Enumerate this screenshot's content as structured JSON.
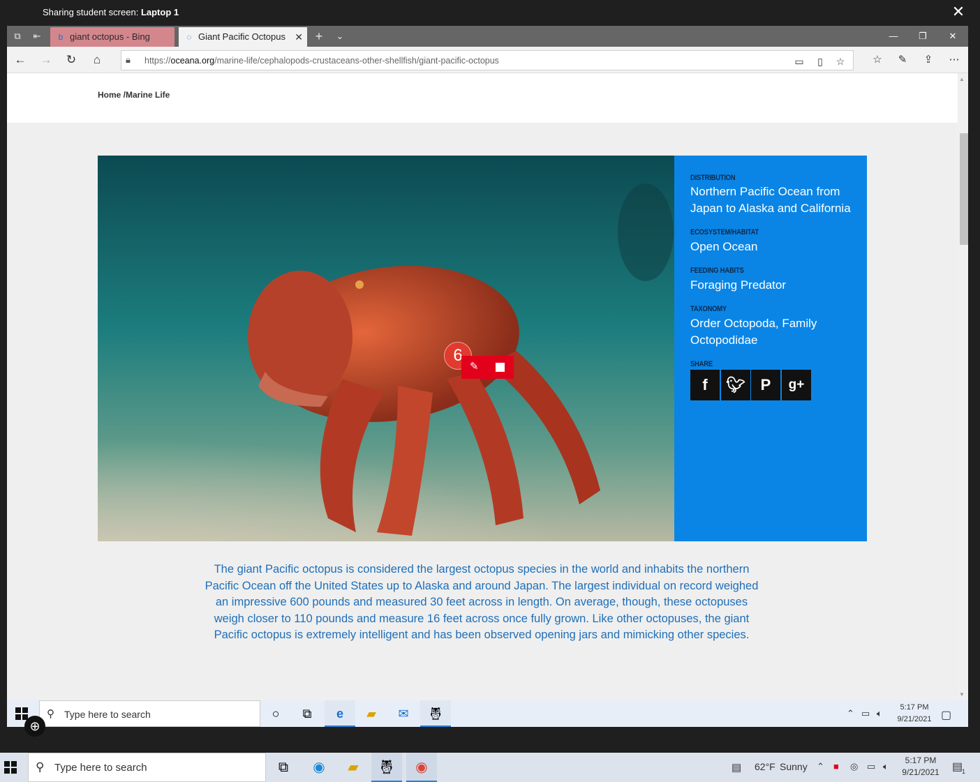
{
  "share_bar": {
    "prefix": "Sharing student screen:",
    "device": "Laptop 1"
  },
  "tabs": [
    {
      "label": "giant octopus - Bing"
    },
    {
      "label": "Giant Pacific Octopus"
    }
  ],
  "address": {
    "url_prefix": "https://",
    "url_domain": "oceana.org",
    "url_path": "/marine-life/cephalopods-crustaceans-other-shellfish/giant-pacific-octopus"
  },
  "breadcrumb": "Home /Marine Life",
  "info": {
    "distribution_label": "DISTRIBUTION",
    "distribution_value": "Northern Pacific Ocean from Japan to Alaska and California",
    "habitat_label": "ECOSYSTEM/HABITAT",
    "habitat_value": "Open Ocean",
    "feeding_label": "FEEDING HABITS",
    "feeding_value": "Foraging Predator",
    "taxonomy_label": "TAXONOMY",
    "taxonomy_value": "Order Octopoda, Family Octopodidae",
    "share_label": "SHARE"
  },
  "recording_badge": "6",
  "description": "The giant Pacific octopus is considered the largest octopus species in the world and inhabits the northern Pacific Ocean off the United States up to Alaska and around Japan. The largest individual on record weighed an impressive 600 pounds and measured 30 feet across in length. On average, though, these octopuses weigh closer to 110 pounds and measure 16 feet across once fully grown. Like other octopuses, the giant Pacific octopus is extremely intelligent and has been observed opening jars and mimicking other species.",
  "inner_taskbar": {
    "search_placeholder": "Type here to search",
    "time": "5:17 PM",
    "date": "9/21/2021"
  },
  "outer_taskbar": {
    "search_placeholder": "Type here to search",
    "weather_temp": "62°F",
    "weather_desc": "Sunny",
    "time": "5:17 PM",
    "date": "9/21/2021",
    "notification_count": "1"
  },
  "colors": {
    "info_bg": "#0a85e6",
    "description_text": "#1f6fb8",
    "record_red": "#e3001b"
  }
}
